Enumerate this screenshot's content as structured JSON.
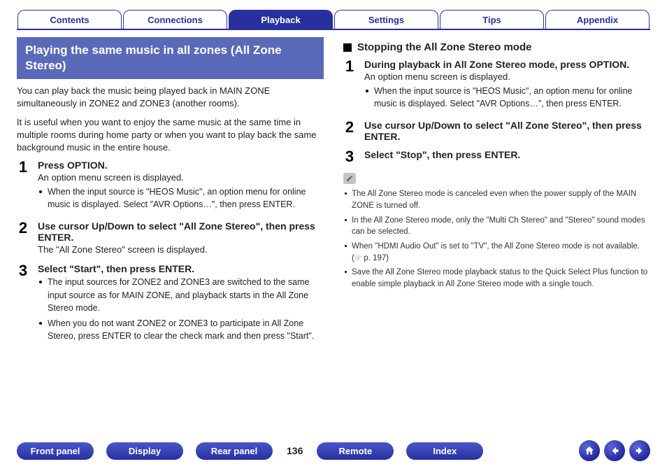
{
  "tabs": {
    "items": [
      {
        "label": "Contents",
        "active": false
      },
      {
        "label": "Connections",
        "active": false
      },
      {
        "label": "Playback",
        "active": true
      },
      {
        "label": "Settings",
        "active": false
      },
      {
        "label": "Tips",
        "active": false
      },
      {
        "label": "Appendix",
        "active": false
      }
    ]
  },
  "left": {
    "heading": "Playing the same music in all zones (All Zone Stereo)",
    "intro1": "You can play back the music being played back in MAIN ZONE simultaneously in ZONE2 and ZONE3 (another rooms).",
    "intro2": "It is useful when you want to enjoy the same music at the same time in multiple rooms during home party or when you want to play back the same background music in the entire house.",
    "steps": [
      {
        "num": "1",
        "title": "Press OPTION.",
        "desc": "An option menu screen is displayed.",
        "bullets": [
          "When the input source is \"HEOS Music\", an option menu for online music is displayed. Select \"AVR Options…\", then press ENTER."
        ]
      },
      {
        "num": "2",
        "title": "Use cursor Up/Down to select \"All Zone Stereo\", then press ENTER.",
        "desc": "The \"All Zone Stereo\" screen is displayed.",
        "bullets": []
      },
      {
        "num": "3",
        "title": "Select \"Start\", then press ENTER.",
        "desc": "",
        "bullets": [
          "The input sources for ZONE2 and ZONE3 are switched to the same input source as for MAIN ZONE, and playback starts in the All Zone Stereo mode.",
          "When you do not want ZONE2 or ZONE3 to participate in All Zone Stereo, press ENTER to clear the check mark and then press \"Start\"."
        ]
      }
    ]
  },
  "right": {
    "subtitle": "Stopping the All Zone Stereo mode",
    "steps": [
      {
        "num": "1",
        "title": "During playback in All Zone Stereo mode, press OPTION.",
        "desc": "An option menu screen is displayed.",
        "bullets": [
          "When the input source is \"HEOS Music\", an option menu for online music is displayed. Select \"AVR Options…\", then press ENTER."
        ]
      },
      {
        "num": "2",
        "title": "Use cursor Up/Down to select \"All Zone Stereo\", then press ENTER.",
        "desc": "",
        "bullets": []
      },
      {
        "num": "3",
        "title": "Select \"Stop\", then press ENTER.",
        "desc": "",
        "bullets": []
      }
    ],
    "notes": [
      "The All Zone Stereo mode is canceled even when the power supply of the MAIN ZONE is turned off.",
      "In the All Zone Stereo mode, only the \"Multi Ch Stereo\" and \"Stereo\" sound modes can be selected.",
      "When \"HDMI Audio Out\" is set to \"TV\", the All Zone Stereo mode is not available. (☞ p. 197)",
      "Save the All Zone Stereo mode playback status to the Quick Select Plus function to enable simple playback in All Zone Stereo mode with a single touch."
    ]
  },
  "bottom": {
    "buttons": [
      "Front panel",
      "Display",
      "Rear panel"
    ],
    "page": "136",
    "buttons2": [
      "Remote",
      "Index"
    ]
  }
}
